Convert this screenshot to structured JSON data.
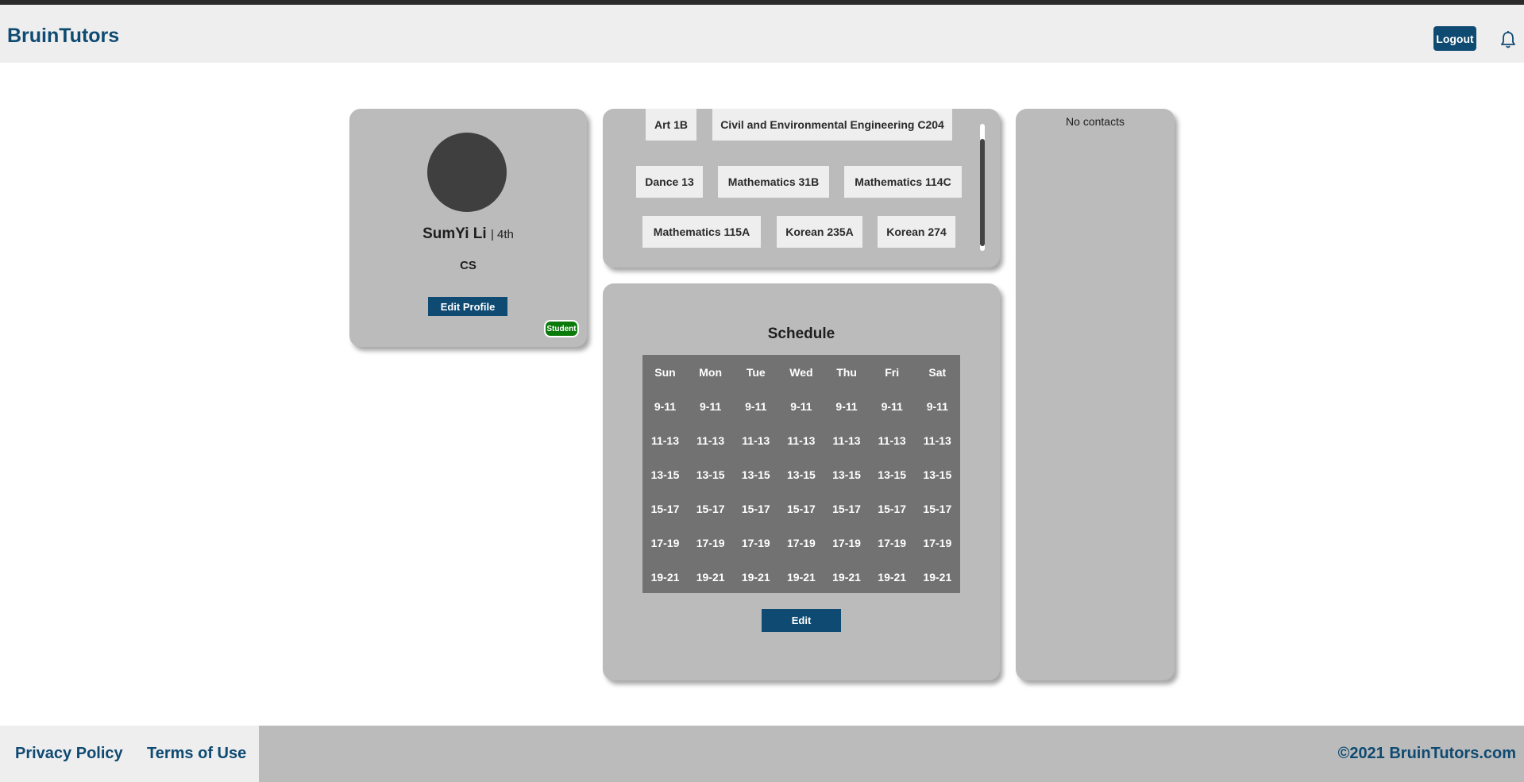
{
  "header": {
    "brand": "BruinTutors",
    "logout_label": "Logout",
    "bell_icon": "bell-icon"
  },
  "profile": {
    "name": "SumYi Li",
    "year": "| 4th",
    "major": "CS",
    "edit_label": "Edit Profile",
    "role_badge": "Student"
  },
  "courses": [
    "Art 1B",
    "Civil and Environmental Engineering C204",
    "Dance 13",
    "Mathematics 31B",
    "Mathematics 114C",
    "Mathematics 115A",
    "Korean 235A",
    "Korean 274"
  ],
  "schedule": {
    "title": "Schedule",
    "days": [
      "Sun",
      "Mon",
      "Tue",
      "Wed",
      "Thu",
      "Fri",
      "Sat"
    ],
    "slots": [
      "9-11",
      "11-13",
      "13-15",
      "15-17",
      "17-19",
      "19-21"
    ],
    "edit_label": "Edit"
  },
  "contacts": {
    "empty_text": "No contacts"
  },
  "footer": {
    "privacy_label": "Privacy Policy",
    "terms_label": "Terms of Use",
    "copyright": "©2021 BruinTutors.com"
  },
  "colors": {
    "brand": "#0e4a72",
    "card_bg": "#bbbbbb",
    "grid_bg": "#727272",
    "badge_green": "#0a7a0a"
  }
}
